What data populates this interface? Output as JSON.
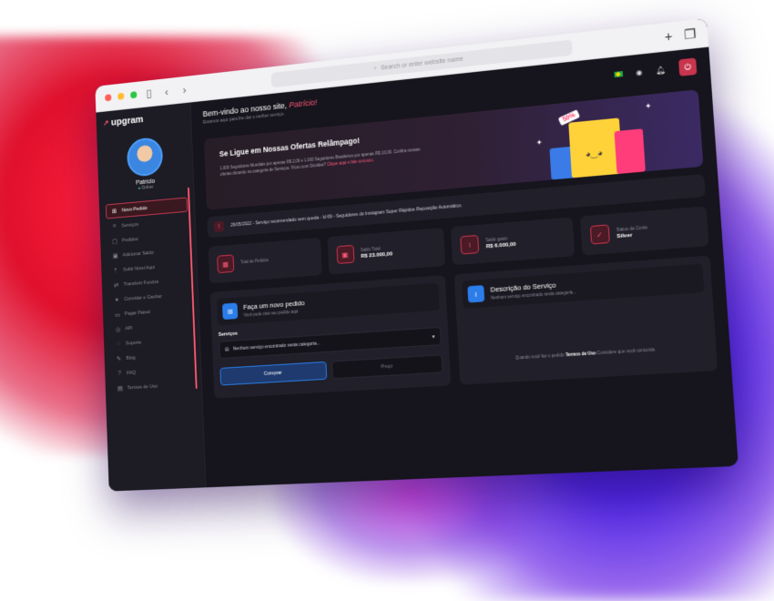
{
  "browser": {
    "url_placeholder": "Search or enter website name",
    "colors": {
      "close": "#ff5f57",
      "min": "#febc2e",
      "max": "#28c840"
    }
  },
  "sidebar": {
    "logo": "upgram",
    "user": {
      "name": "Patrício",
      "status": "Online"
    },
    "items": [
      {
        "label": "Novo Pedido",
        "icon": "cart-icon",
        "active": true
      },
      {
        "label": "Serviços",
        "icon": "list-icon",
        "active": false
      },
      {
        "label": "Pedidos",
        "icon": "box-icon",
        "active": false
      },
      {
        "label": "Adicionar Saldo",
        "icon": "wallet-icon",
        "active": false
      },
      {
        "label": "Subir Nível Aqui",
        "icon": "up-icon",
        "active": false
      },
      {
        "label": "Transferir Fundos",
        "icon": "transfer-icon",
        "active": false
      },
      {
        "label": "Convidar e Ganhar",
        "icon": "gift-icon",
        "active": false
      },
      {
        "label": "Pagar Painel",
        "icon": "card-icon",
        "active": false
      },
      {
        "label": "API",
        "icon": "code-icon",
        "active": false
      },
      {
        "label": "Suporte",
        "icon": "support-icon",
        "active": false
      },
      {
        "label": "Blog",
        "icon": "blog-icon",
        "active": false
      },
      {
        "label": "FAQ",
        "icon": "help-icon",
        "active": false
      },
      {
        "label": "Termos de Uso",
        "icon": "doc-icon",
        "active": false
      }
    ]
  },
  "header": {
    "welcome_prefix": "Bem-vindo ao nosso site,",
    "welcome_name": "Patrício!",
    "subtitle": "Estamos aqui para lhe dar o melhor serviço."
  },
  "banner": {
    "title": "Se Ligue em Nossas Ofertas Relâmpago!",
    "text": "1.000 Seguidores Mundiais por apenas R$ 2,00 e 1.000 Seguidores Brasileiros por apenas R$ 10,00. Confira nossas ofertas clicando na categoria de Serviços. Ficou com Dúvidas?",
    "link": "Clique aqui e fale conosco.",
    "tag": "50%"
  },
  "notice": {
    "text": "26/05/2022 - Serviço recomendado sem queda - Id 69 - Seguidores do Instagram Super Rápidos Reposição Automático."
  },
  "stats": [
    {
      "label": "Total de Pedidos",
      "value": "",
      "icon": "order-icon"
    },
    {
      "label": "Saldo Total",
      "value": "R$ 23.000,00",
      "icon": "wallet-icon"
    },
    {
      "label": "Saldo gasto",
      "value": "R$ 6.000,00",
      "icon": "spent-icon"
    },
    {
      "label": "Status da Conta",
      "value": "Silver",
      "icon": "shield-icon"
    }
  ],
  "order": {
    "title": "Faça um novo pedido",
    "desc": "Você pode criar seu pedido aqui",
    "services_label": "Serviços",
    "select_value": "Nenhum serviço encontrado nesta categoria...",
    "buy_label": "Comprar",
    "price_placeholder": "Preço"
  },
  "description": {
    "title": "Descrição do Serviço",
    "desc": "Nenhum serviço encontrado nesta categoria...",
    "terms_prefix": "Quando você faz o pedido",
    "terms_link": "Termos de Uso",
    "terms_suffix": "Considere que você concorda."
  }
}
